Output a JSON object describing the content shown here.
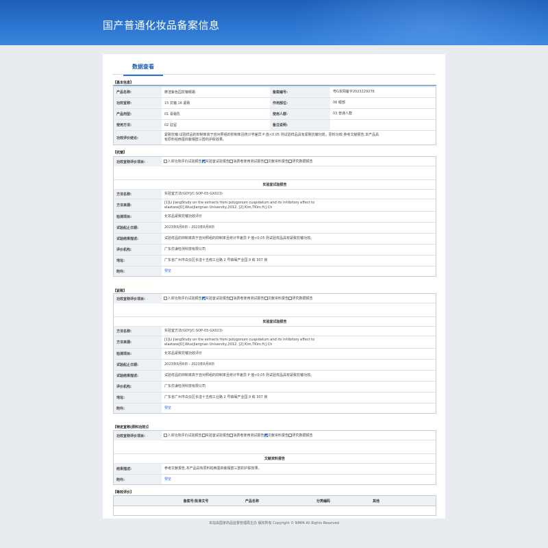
{
  "header": {
    "title": "国产普通化妆品备案信息"
  },
  "tab": {
    "label": "数据查看"
  },
  "basic": {
    "title": "【基本信息】",
    "product_name_label": "产品名称:",
    "product_name": "摩渲紫色园抗皱眼霜",
    "record_no_label": "备案编号:",
    "record_no": "粤G妆网备字2023229276",
    "efficacy_claim_label": "功效宣称:",
    "efficacy_claim": "15 抗皱,16 紧致",
    "usage_part_label": "作用部位:",
    "usage_part": "06 眼部",
    "dosage_form_label": "产品剂型:",
    "dosage_form": "01 膏霜乳",
    "target_group_label": "使用人群:",
    "target_group": "03 普通人群",
    "usage_method_label": "使用方法:",
    "usage_method": "02 驻留",
    "remarks_label": "备注说明:",
    "remarks": "",
    "conclusion_label": "功效评价结论:",
    "conclusion": "紧致抗皱:试验样品的抑制率高于自对照组的抑制率且统计学差异 P 值<0.05 则试验样品具有紧致抗皱功效。原料功效:参考文献报告,本产品具有原料柏西墨四紫檀醇三醇的护肤效果。"
  },
  "sections": [
    {
      "title": "【抗皱】",
      "eval_label": "功效宣称评价项目:",
      "options": [
        {
          "label": "人体功效评价试验报告",
          "checked": false
        },
        {
          "label": "实验室试验报告",
          "checked": true
        },
        {
          "label": "消费者使用测试报告",
          "checked": false
        },
        {
          "label": "文献资料报告",
          "checked": false
        },
        {
          "label": "研究数据报告",
          "checked": false
        }
      ],
      "subhead": "实验室试验报告",
      "method_name_label": "方法名称:",
      "method_name": "实验室方法(GDYJ/C-SOP-03-GX023)",
      "method_source_label": "方法来源:",
      "method_source": "[1]Li JiangStudy on the extracts from polygonum cuspidatum and its inhibitory effect to elastase[D].WuxiJiangnan University,2012. [2] Kim,TKim,H.J.Ch",
      "test_item_label": "检测项目:",
      "test_item": "化妆品紧致抗皱功效评价",
      "test_date_label": "试验起止日期:",
      "test_date": "2023年6月8日 - 2023年6月8日",
      "result_label": "试验结果描述:",
      "result": "试验样品的抑制率高于自对照组的抑制率且统计学差异 P 值<0.05 则试验样品具有紧致抗皱功效。",
      "org_label": "评价机构:",
      "org": "广东优谦检测科技有限公司",
      "address_label": "地址:",
      "address": "广东省广州市白云区长湴十五南工业路 2 号锦闽产业园 9 栋 307 房",
      "attach_label": "附件:",
      "attach": "预览"
    },
    {
      "title": "【紧致】",
      "eval_label": "功效宣称评价项目:",
      "options": [
        {
          "label": "人体功效评价试验报告",
          "checked": false
        },
        {
          "label": "实验室试验报告",
          "checked": true
        },
        {
          "label": "消费者使用测试报告",
          "checked": false
        },
        {
          "label": "文献资料报告",
          "checked": false
        },
        {
          "label": "研究数据报告",
          "checked": false
        }
      ],
      "subhead": "实验室试验报告",
      "method_name_label": "方法名称:",
      "method_name": "实验室方法(GDYJ/C-SOP-03-GX023)",
      "method_source_label": "方法来源:",
      "method_source": "[1]Li JiangStudy on the extracts from polygonum cuspidatum and its inhibitory effect to elastase[D].WuxiJiangnan University,2012. [2] Kim,TKim,H.J.Ch",
      "test_item_label": "检测项目:",
      "test_item": "化妆品紧致抗皱功效评价",
      "test_date_label": "试验起止日期:",
      "test_date": "2023年6月8日 - 2023年6月8日",
      "result_label": "试验结果描述:",
      "result": "试验样品的抑制率高于自对照组的抑制率且统计学差异 P 值<0.05 则试验样品具有紧致抗皱功效。",
      "org_label": "评价机构:",
      "org": "广东优谦检测科技有限公司",
      "address_label": "地址:",
      "address": "广东省广州市白云区长湴十五南工业路 2 号锦闽产业园 9 栋 307 房",
      "attach_label": "附件:",
      "attach": "预览"
    }
  ],
  "special": {
    "title": "【特定宣称(原料功效)】",
    "eval_label": "功效宣称评价项目:",
    "options": [
      {
        "label": "人体功效评价试验报告",
        "checked": false
      },
      {
        "label": "实验室试验报告",
        "checked": false
      },
      {
        "label": "消费者使用测试报告",
        "checked": false
      },
      {
        "label": "文献资料报告",
        "checked": true
      },
      {
        "label": "研究数据报告",
        "checked": false
      }
    ],
    "subhead": "文献资料报告",
    "result_label": "结果描述:",
    "result": "参考文献报告,本产品具有原料柏西墨四紫檀醇三醇的护肤效果。",
    "attach_label": "附件:",
    "attach": "预览"
  },
  "equivalent": {
    "title": "【等效评价】",
    "columns": [
      "备案号/批准文号",
      "产品名称",
      "分类编码",
      "其他"
    ]
  },
  "footer": {
    "text": "本站由国家药品监督管理局主办 版权所有 Copyright © NMPA All Rights Reserved"
  }
}
